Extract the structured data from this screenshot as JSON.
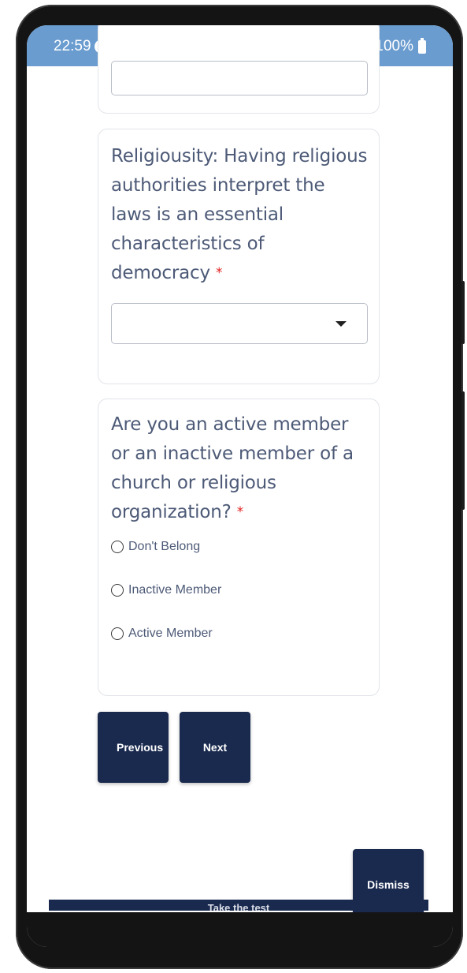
{
  "status_bar": {
    "time": "22:59",
    "signal": ".ıl",
    "battery": "100%"
  },
  "questions": [
    {
      "text": "Religiousity: Having religious authorities interpret the laws is an essential characteristics of democracy",
      "required_mark": "*",
      "type": "select",
      "selected_value": ""
    },
    {
      "text": "Are you an active member or an inactive member of a church or religious organization?",
      "required_mark": "*",
      "type": "radio",
      "options": [
        "Don't Belong",
        "Inactive Member",
        "Active Member"
      ]
    }
  ],
  "nav": {
    "previous_label": "Previous",
    "next_label": "Next"
  },
  "dismiss_label": "Dismiss",
  "banner_label": "Take the test",
  "colors": {
    "status_bar": "#6a9ccf",
    "button": "#1a2a4f",
    "question_text": "#4d5a77",
    "required": "#e02020"
  }
}
